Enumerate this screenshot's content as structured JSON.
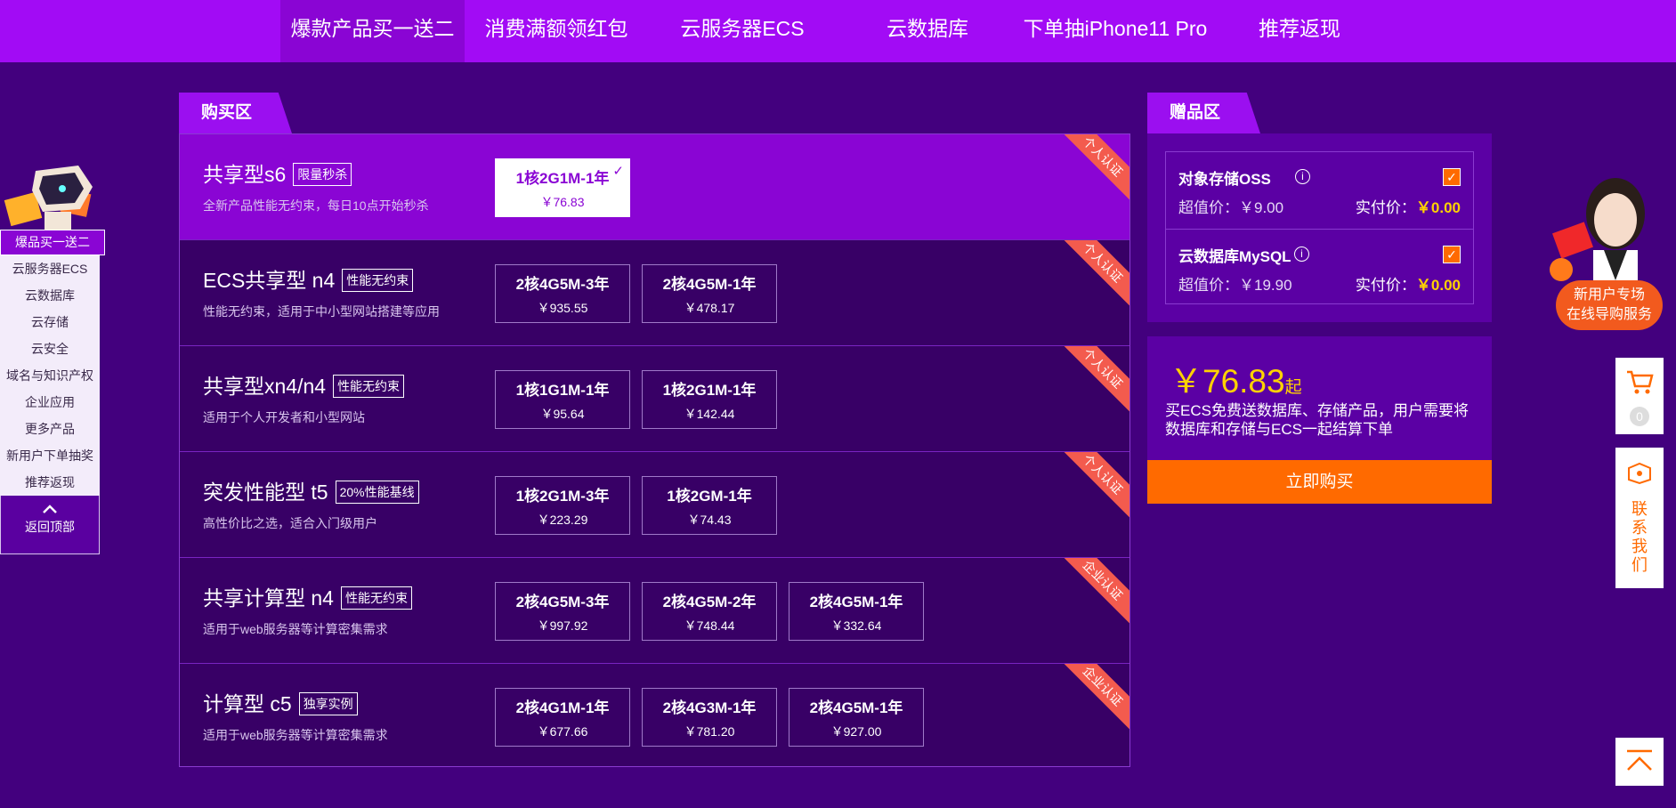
{
  "nav": {
    "tabs": [
      {
        "label": "爆款产品买一送二"
      },
      {
        "label": "消费满额领红包"
      },
      {
        "label": "云服务器ECS"
      },
      {
        "label": "云数据库"
      },
      {
        "label": "下单抽iPhone11 Pro"
      },
      {
        "label": "推荐返现"
      }
    ],
    "active_index": 0
  },
  "sidebar": {
    "first": "爆品买一送二",
    "items": [
      "云服务器ECS",
      "云数据库",
      "云存储",
      "云安全",
      "域名与知识产权",
      "企业应用",
      "更多产品",
      "新用户下单抽奖",
      "推荐返现"
    ],
    "back_top": "返回顶部"
  },
  "buy": {
    "tab_label": "购买区",
    "products": [
      {
        "name": "共享型s6",
        "badge": "限量秒杀",
        "desc": "全新产品性能无约束，每日10点开始秒杀",
        "ribbon": "个人认证",
        "options": [
          {
            "spec": "1核2G1M-1年",
            "price": "￥76.83",
            "selected": true
          }
        ]
      },
      {
        "name": "ECS共享型 n4",
        "badge": "性能无约束",
        "desc": "性能无约束，适用于中小型网站搭建等应用",
        "ribbon": "个人认证",
        "options": [
          {
            "spec": "2核4G5M-3年",
            "price": "￥935.55"
          },
          {
            "spec": "2核4G5M-1年",
            "price": "￥478.17"
          }
        ]
      },
      {
        "name": "共享型xn4/n4",
        "badge": "性能无约束",
        "desc": "适用于个人开发者和小型网站",
        "ribbon": "个人认证",
        "options": [
          {
            "spec": "1核1G1M-1年",
            "price": "￥95.64"
          },
          {
            "spec": "1核2G1M-1年",
            "price": "￥142.44"
          }
        ]
      },
      {
        "name": "突发性能型 t5",
        "badge": "20%性能基线",
        "desc": "高性价比之选，适合入门级用户",
        "ribbon": "个人认证",
        "options": [
          {
            "spec": "1核2G1M-3年",
            "price": "￥223.29"
          },
          {
            "spec": "1核2GM-1年",
            "price": "￥74.43"
          }
        ]
      },
      {
        "name": "共享计算型 n4",
        "badge": "性能无约束",
        "desc": "适用于web服务器等计算密集需求",
        "ribbon": "企业认证",
        "options": [
          {
            "spec": "2核4G5M-3年",
            "price": "￥997.92"
          },
          {
            "spec": "2核4G5M-2年",
            "price": "￥748.44"
          },
          {
            "spec": "2核4G5M-1年",
            "price": "￥332.64"
          }
        ]
      },
      {
        "name": "计算型 c5",
        "badge": "独享实例",
        "desc": "适用于web服务器等计算密集需求",
        "ribbon": "企业认证",
        "options": [
          {
            "spec": "2核4G1M-1年",
            "price": "￥677.66"
          },
          {
            "spec": "2核4G3M-1年",
            "price": "￥781.20"
          },
          {
            "spec": "2核4G5M-1年",
            "price": "￥927.00"
          }
        ]
      }
    ]
  },
  "gift": {
    "tab_label": "赠品区",
    "items": [
      {
        "name": "对象存储OSS",
        "value_label": "超值价：￥9.00",
        "real_label": "实付价：",
        "real_value": "￥0.00",
        "checked": true
      },
      {
        "name": "云数据库MySQL",
        "value_label": "超值价：￥19.90",
        "real_label": "实付价：",
        "real_value": "￥0.00",
        "checked": true
      }
    ]
  },
  "summary": {
    "price": "￥76.83",
    "price_suffix": "起",
    "desc": "买ECS免费送数据库、存储产品，用户需要将数据库和存储与ECS一起结算下单",
    "buy_label": "立即购买"
  },
  "right": {
    "new_user_line1": "新用户专场",
    "new_user_line2": "在线导购服务",
    "cart_count": "0",
    "contact_label": "联系我们"
  },
  "colors": {
    "background": "#43007e",
    "nav": "#a20bf5",
    "accent_orange": "#ff6a00",
    "price_yellow": "#ffd200",
    "ribbon": "#f35b4e"
  }
}
